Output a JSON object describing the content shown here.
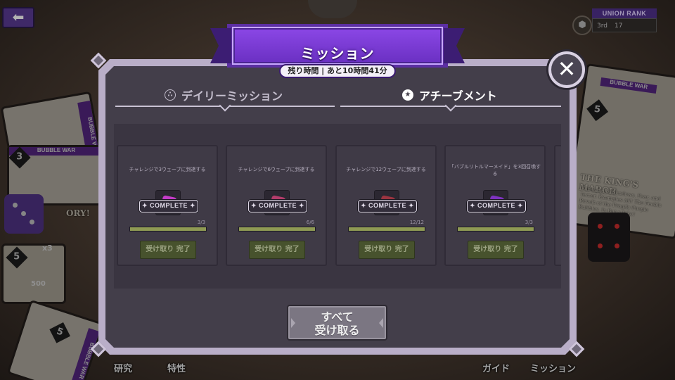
{
  "background": {
    "back_icon": "arrow-left-icon",
    "union_rank": {
      "label": "UNION RANK",
      "rank": "3rd",
      "points": "17"
    },
    "card_labels": [
      "BUBBLE WAR",
      "BUBBLE WAR",
      "BUBBLE WAR",
      "BUBBLE WAR"
    ],
    "board_text": {
      "kings_march": "THE KING'S MARCH",
      "story": "ORY!",
      "flavor": "The Land of Shadows, Fear, and Terror. Examples All! The Feeble Revolt of the Fragile Purple Bubbles. Is But a Joke!"
    },
    "card_numbers": [
      "5",
      "3",
      "5",
      "5"
    ],
    "count_x3": "x3",
    "count_500": "500",
    "bottom_nav": [
      "研究",
      "特性",
      "ガイド",
      "ミッション"
    ]
  },
  "modal": {
    "title": "ミッション",
    "remaining_time": "残り時間 | あと10時間41分",
    "close_icon": "close-icon",
    "tabs": [
      {
        "label": "デイリーミッション",
        "icon": "three-dots-circle-icon",
        "active": false
      },
      {
        "label": "アチーブメント",
        "icon": "star-circle-icon",
        "active": true
      }
    ],
    "missions": [
      {
        "description": "チャレンジで3ウェーブに到達する",
        "badge": "✦ COMPLETE ✦",
        "progress": "3/3",
        "progress_fraction": 1.0,
        "claim_label": "受け取り 完了",
        "gem_color": "#c43cc8"
      },
      {
        "description": "チャレンジで6ウェーブに到達する",
        "badge": "✦ COMPLETE ✦",
        "progress": "6/6",
        "progress_fraction": 1.0,
        "claim_label": "受け取り 完了",
        "gem_color": "#b23c6a"
      },
      {
        "description": "チャレンジで12ウェーブに到達する",
        "badge": "✦ COMPLETE ✦",
        "progress": "12/12",
        "progress_fraction": 1.0,
        "claim_label": "受け取り 完了",
        "gem_color": "#9b3440"
      },
      {
        "description": "「バブルリトルマーメイド」を3回召喚する",
        "badge": "✦ COMPLETE ✦",
        "progress": "3/3",
        "progress_fraction": 1.0,
        "claim_label": "受け取り 完了",
        "gem_color": "#7e32c0"
      }
    ],
    "receive_all": {
      "line1": "すべて",
      "line2": "受け取る"
    }
  },
  "colors": {
    "banner": "#7a3ad8",
    "frame": "#b9aec8",
    "panel": "#433e4a",
    "progress": "#8f9a54",
    "claim_disabled": "#47522d"
  }
}
